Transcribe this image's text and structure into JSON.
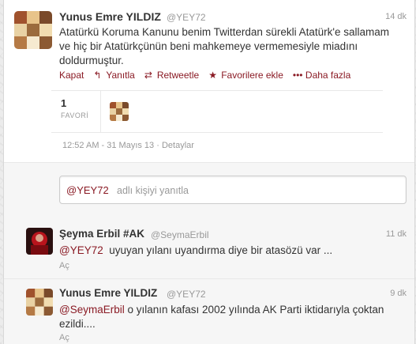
{
  "main_tweet": {
    "name": "Yunus Emre YILDIZ",
    "handle": "@YEY72",
    "time": "14 dk",
    "text": "Atatürkü Koruma Kanunu benim Twitterdan sürekli Atatürk'e sallamam ve hiç bir Atatürkçünün beni mahkemeye vermemesiyle miadını doldurmuştur.",
    "actions": {
      "close": "Kapat",
      "reply": "Yanıtla",
      "retweet": "Retweetle",
      "favorite": "Favorilere ekle",
      "more": "Daha fazla"
    },
    "favorites_count": "1",
    "favorites_label": "FAVORİ",
    "timestamp": "12:52 AM - 31 Mayıs 13",
    "details": "Detaylar"
  },
  "reply_box": {
    "mention": "@YEY72",
    "placeholder": "adlı kişiyi yanıtla"
  },
  "replies": [
    {
      "name": "Şeyma Erbil #AK",
      "handle": "@SeymaErbil",
      "time": "11 dk",
      "mention": "@YEY72",
      "text": "uyuyan yılanı uyandırma diye bir atasözü var ...",
      "expand": "Aç"
    },
    {
      "name": "Yunus Emre YILDIZ",
      "handle": "@YEY72",
      "time": "9 dk",
      "mention": "@SeymaErbil",
      "text": "o yılanın kafası 2002 yılında AK Parti iktidarıyla çoktan ezildi....",
      "expand": "Aç"
    }
  ],
  "colors": {
    "link": "#8a1a24",
    "muted": "#999999"
  }
}
